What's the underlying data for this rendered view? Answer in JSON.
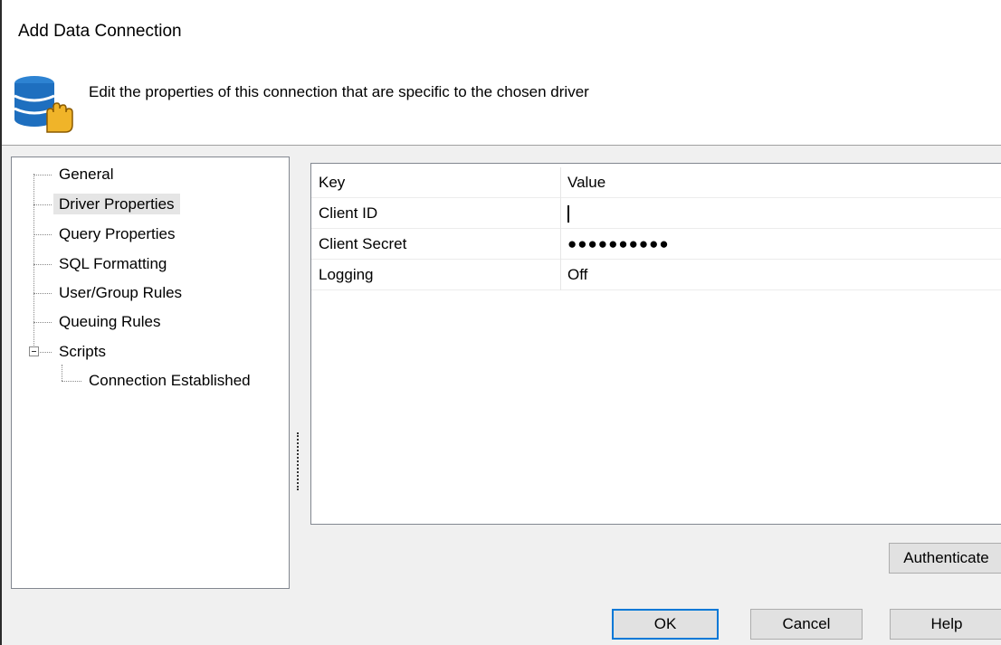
{
  "dialog": {
    "title": "Add Data Connection",
    "subtitle": "Edit the properties of this connection that are specific to the chosen driver",
    "icon": "database-lock-icon"
  },
  "tree": {
    "items": [
      {
        "label": "General"
      },
      {
        "label": "Driver Properties",
        "selected": true
      },
      {
        "label": "Query Properties"
      },
      {
        "label": "SQL Formatting"
      },
      {
        "label": "User/Group Rules"
      },
      {
        "label": "Queuing Rules"
      },
      {
        "label": "Scripts",
        "expanded": true
      },
      {
        "label": "Connection Established",
        "child_of": "Scripts"
      }
    ]
  },
  "grid": {
    "headers": {
      "key": "Key",
      "value": "Value"
    },
    "rows": [
      {
        "key": "Client ID",
        "value": ""
      },
      {
        "key": "Client Secret",
        "value": "●●●●●●●●●●"
      },
      {
        "key": "Logging",
        "value": "Off"
      }
    ]
  },
  "buttons": {
    "authenticate": "Authenticate",
    "ok": "OK",
    "cancel": "Cancel",
    "help": "Help"
  },
  "colors": {
    "accent": "#0078d7",
    "icon_blue": "#1e6fbf",
    "icon_hand": "#f0b429"
  }
}
